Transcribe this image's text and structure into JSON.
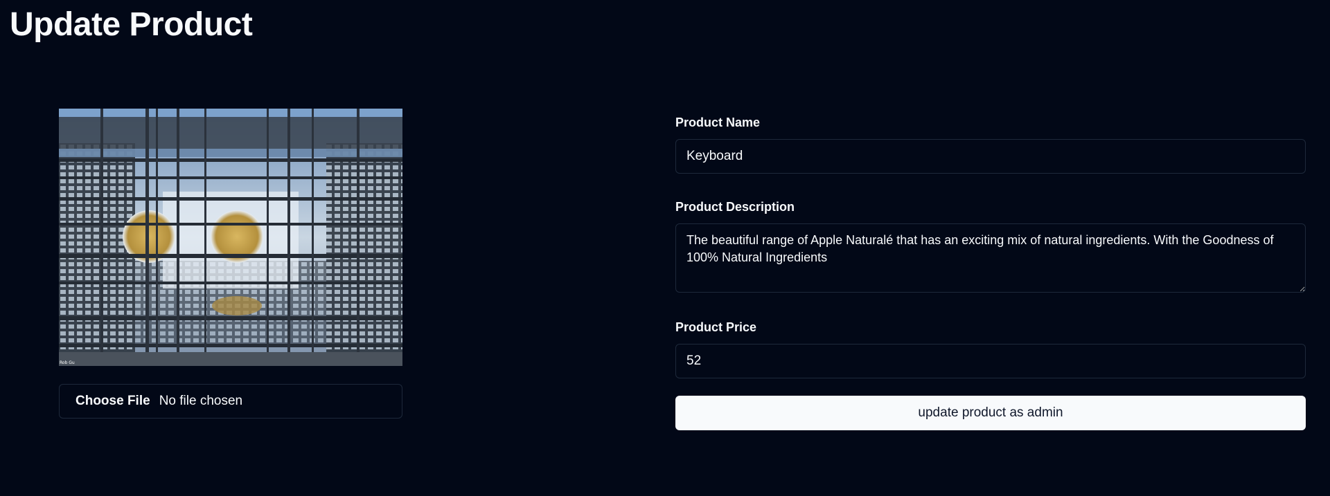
{
  "page": {
    "title": "Update Product"
  },
  "image": {
    "alt": "Product image: glass atrium roof viewed from below",
    "credit": "Rob Gu",
    "icon": "product-photo"
  },
  "file_input": {
    "button_label": "Choose File",
    "status": "No file chosen"
  },
  "form": {
    "name_label": "Product Name",
    "name_value": "Keyboard",
    "description_label": "Product Description",
    "description_value": "The beautiful range of Apple Naturalé that has an exciting mix of natural ingredients. With the Goodness of 100% Natural Ingredients",
    "price_label": "Product Price",
    "price_value": "52",
    "submit_label": "update product as admin"
  },
  "colors": {
    "background": "#020817",
    "text": "#f8fafc",
    "border": "#1e293b",
    "button_bg": "#f8fafc",
    "button_text": "#0f172a"
  }
}
